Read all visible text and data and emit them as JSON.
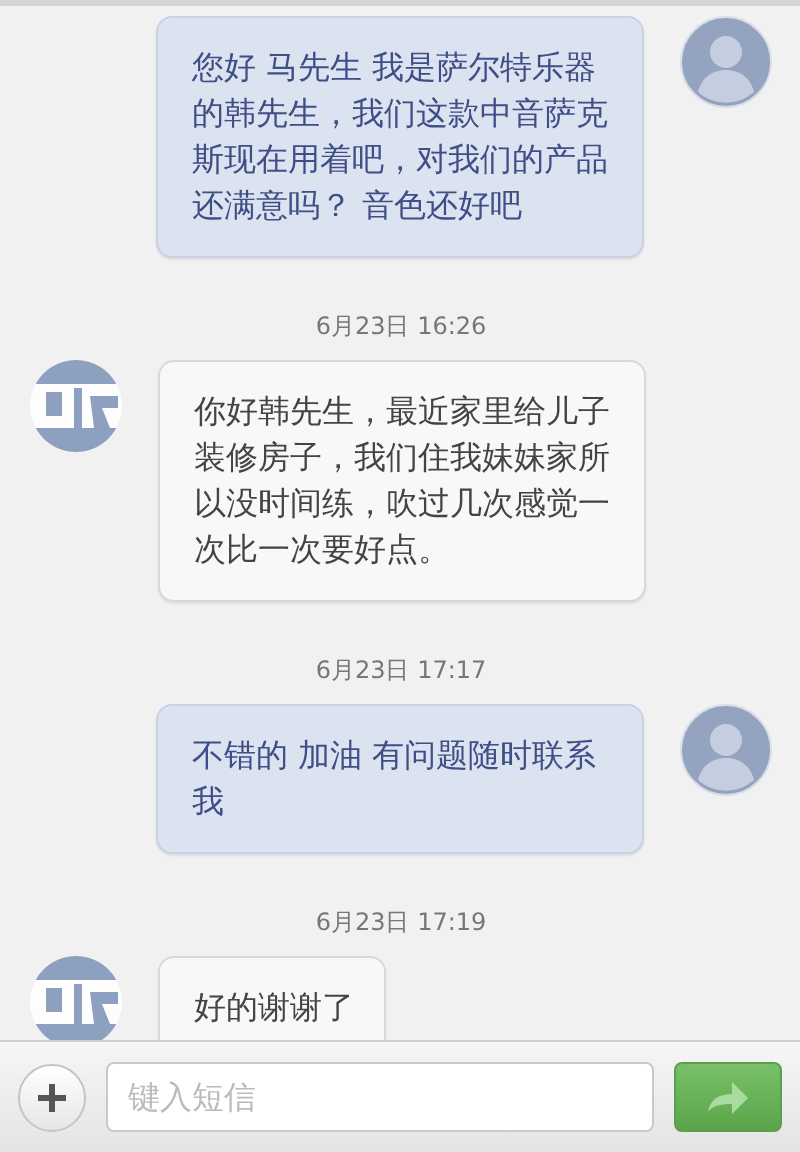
{
  "messages": [
    {
      "kind": "outgoing",
      "text": "您好 马先生 我是萨尔特乐器的韩先生，我们这款中音萨克斯现在用着吧，对我们的产品还满意吗？ 音色还好吧"
    },
    {
      "kind": "timestamp",
      "text": "6月23日 16:26"
    },
    {
      "kind": "incoming",
      "text": "你好韩先生，最近家里给儿子装修房子，我们住我妹妹家所以没时间练，吹过几次感觉一次比一次要好点。"
    },
    {
      "kind": "timestamp",
      "text": "6月23日 17:17"
    },
    {
      "kind": "outgoing",
      "text": "不错的 加油 有问题随时联系我"
    },
    {
      "kind": "timestamp",
      "text": "6月23日 17:19"
    },
    {
      "kind": "incoming",
      "text": "好的谢谢了"
    }
  ],
  "composer": {
    "placeholder": "键入短信"
  }
}
